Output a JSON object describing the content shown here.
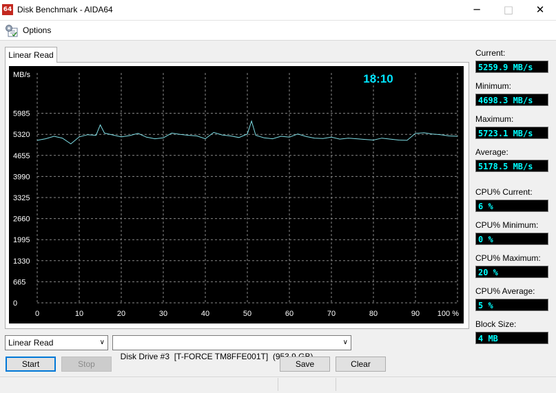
{
  "window": {
    "title": "Disk Benchmark - AIDA64",
    "app_icon_text": "64"
  },
  "menu": {
    "options_label": "Options"
  },
  "tab": {
    "label": "Linear Read"
  },
  "chart_data": {
    "type": "line",
    "ylabel": "MB/s",
    "timer": "18:10",
    "y_ticks": [
      "5985",
      "5320",
      "4655",
      "3990",
      "3325",
      "2660",
      "1995",
      "1330",
      "665",
      "0"
    ],
    "x_ticks": [
      "0",
      "10",
      "20",
      "30",
      "40",
      "50",
      "60",
      "70",
      "80",
      "90",
      "100 %"
    ],
    "ylim": [
      0,
      6650
    ],
    "xlim": [
      0,
      100
    ],
    "grid": true,
    "line_color": "#7fe0e8",
    "series": [
      {
        "x": [
          0,
          2,
          4,
          6,
          8,
          10,
          12,
          14,
          15,
          16,
          18,
          20,
          22,
          24,
          26,
          28,
          30,
          32,
          34,
          36,
          38,
          40,
          42,
          44,
          46,
          48,
          50,
          51,
          52,
          54,
          56,
          58,
          60,
          62,
          64,
          66,
          68,
          70,
          72,
          74,
          76,
          78,
          80,
          82,
          84,
          86,
          88,
          90,
          92,
          94,
          96,
          98,
          100
        ],
        "values": [
          5130,
          5180,
          5260,
          5200,
          5020,
          5240,
          5310,
          5290,
          5620,
          5360,
          5300,
          5240,
          5280,
          5350,
          5230,
          5180,
          5210,
          5360,
          5320,
          5290,
          5270,
          5180,
          5380,
          5300,
          5270,
          5220,
          5330,
          5740,
          5290,
          5210,
          5180,
          5260,
          5230,
          5330,
          5250,
          5200,
          5190,
          5230,
          5170,
          5200,
          5180,
          5160,
          5140,
          5200,
          5170,
          5140,
          5130,
          5350,
          5370,
          5330,
          5310,
          5270,
          5260
        ]
      }
    ]
  },
  "stats": {
    "current_label": "Current:",
    "current_value": "5259.9 MB/s",
    "minimum_label": "Minimum:",
    "minimum_value": "4698.3 MB/s",
    "maximum_label": "Maximum:",
    "maximum_value": "5723.1 MB/s",
    "average_label": "Average:",
    "average_value": "5178.5 MB/s",
    "cpu_current_label": "CPU% Current:",
    "cpu_current_value": "6 %",
    "cpu_minimum_label": "CPU% Minimum:",
    "cpu_minimum_value": "0 %",
    "cpu_maximum_label": "CPU% Maximum:",
    "cpu_maximum_value": "20 %",
    "cpu_average_label": "CPU% Average:",
    "cpu_average_value": "5 %",
    "block_size_label": "Block Size:",
    "block_size_value": "4 MB"
  },
  "controls": {
    "test_select": "Linear Read",
    "drive_select": "Disk Drive #3  [T-FORCE TM8FFE001T]  (953.9 GB)",
    "start_label": "Start",
    "stop_label": "Stop",
    "save_label": "Save",
    "clear_label": "Clear"
  }
}
